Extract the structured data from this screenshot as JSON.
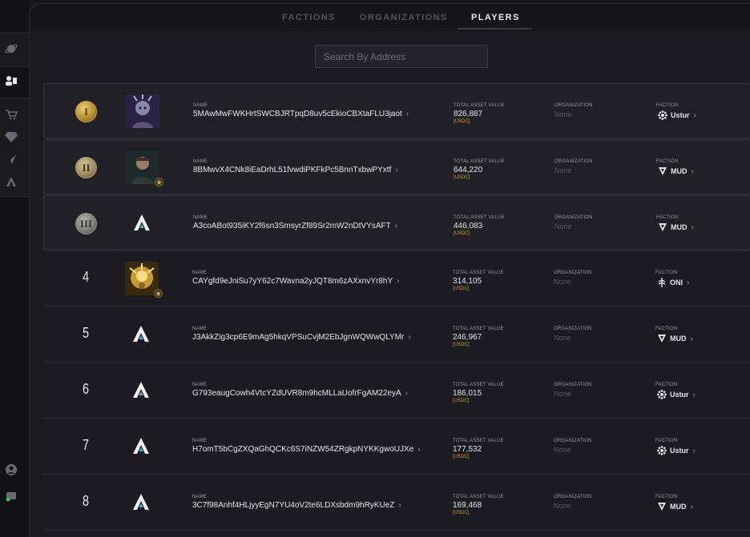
{
  "tabs": [
    {
      "label": "FACTIONS",
      "active": false
    },
    {
      "label": "ORGANIZATIONS",
      "active": false
    },
    {
      "label": "PLAYERS",
      "active": true
    }
  ],
  "search": {
    "placeholder": "Search By Address"
  },
  "columns": {
    "name": "NAME",
    "asset": "TOTAL ASSET VALUE",
    "unit": "[USDC]",
    "organization": "ORGANIZATION",
    "faction": "FACTION"
  },
  "players": [
    {
      "rank": "1",
      "rank_display": "I",
      "medal": "gold",
      "avatar": "portrait-alien",
      "address": "5MAwMwFWKHrtSWCBJRTpqD8uv5cEkioCBXtaFLU3jaot",
      "asset_value": "826,887",
      "organization": "None",
      "faction": "Ustur",
      "faction_icon": "ustur-icon"
    },
    {
      "rank": "2",
      "rank_display": "II",
      "medal": "silver",
      "avatar": "portrait-soldier",
      "address": "8BMwvX4CNk8iEaDrhL51fvwdiPKFkPc5BnnTxbwPYxtf",
      "asset_value": "644,220",
      "organization": "None",
      "faction": "MUD",
      "faction_icon": "mud-icon"
    },
    {
      "rank": "3",
      "rank_display": "III",
      "medal": "bronze",
      "avatar": "star-atlas-logo",
      "address": "A3coABot935iKY2f6sn3SmsyrZf89Sr2mW2nDtVYsAFT",
      "asset_value": "446,083",
      "organization": "None",
      "faction": "MUD",
      "faction_icon": "mud-icon"
    },
    {
      "rank": "4",
      "rank_display": "4",
      "medal": "",
      "avatar": "portrait-golden",
      "address": "CAYgfd9eJniSu7yY62c7Wavna2yJQT8m6zAXxnvYr8hY",
      "asset_value": "314,105",
      "organization": "None",
      "faction": "ONI",
      "faction_icon": "oni-icon"
    },
    {
      "rank": "5",
      "rank_display": "5",
      "medal": "",
      "avatar": "star-atlas-logo",
      "address": "J3AkkZig3cp6E9mAg5hkqVPSuCvjM2EbJgnWQWwQLYMr",
      "asset_value": "246,967",
      "organization": "None",
      "faction": "MUD",
      "faction_icon": "mud-icon"
    },
    {
      "rank": "6",
      "rank_display": "6",
      "medal": "",
      "avatar": "star-atlas-logo",
      "address": "G793eaugCowh4VtcYZdUVR8m9hcMLLaUofrFgAM22eyA",
      "asset_value": "186,015",
      "organization": "None",
      "faction": "Ustur",
      "faction_icon": "ustur-icon"
    },
    {
      "rank": "7",
      "rank_display": "7",
      "medal": "",
      "avatar": "star-atlas-logo",
      "address": "H7omT5bCgZXQaGhQCKc6S7iNZW54ZRgkpNYKKgwoUJXe",
      "asset_value": "177,532",
      "organization": "None",
      "faction": "Ustur",
      "faction_icon": "ustur-icon"
    },
    {
      "rank": "8",
      "rank_display": "8",
      "medal": "",
      "avatar": "star-atlas-logo",
      "address": "3C7f98Anhf4HLjyyEgN7YU4oV2te6LDXsbdm9hRyKUeZ",
      "asset_value": "169,468",
      "organization": "None",
      "faction": "MUD",
      "faction_icon": "mud-icon"
    }
  ],
  "sidebar": {
    "icons": [
      "planet-icon",
      "players-icon",
      "cart-icon",
      "diamond-icon",
      "ship-icon",
      "star-atlas-icon",
      "account-icon",
      "wallet-icon"
    ]
  },
  "colors": {
    "accent_gold": "#c9a13d",
    "background": "#1b1b21",
    "text": "#e6e6ea"
  }
}
